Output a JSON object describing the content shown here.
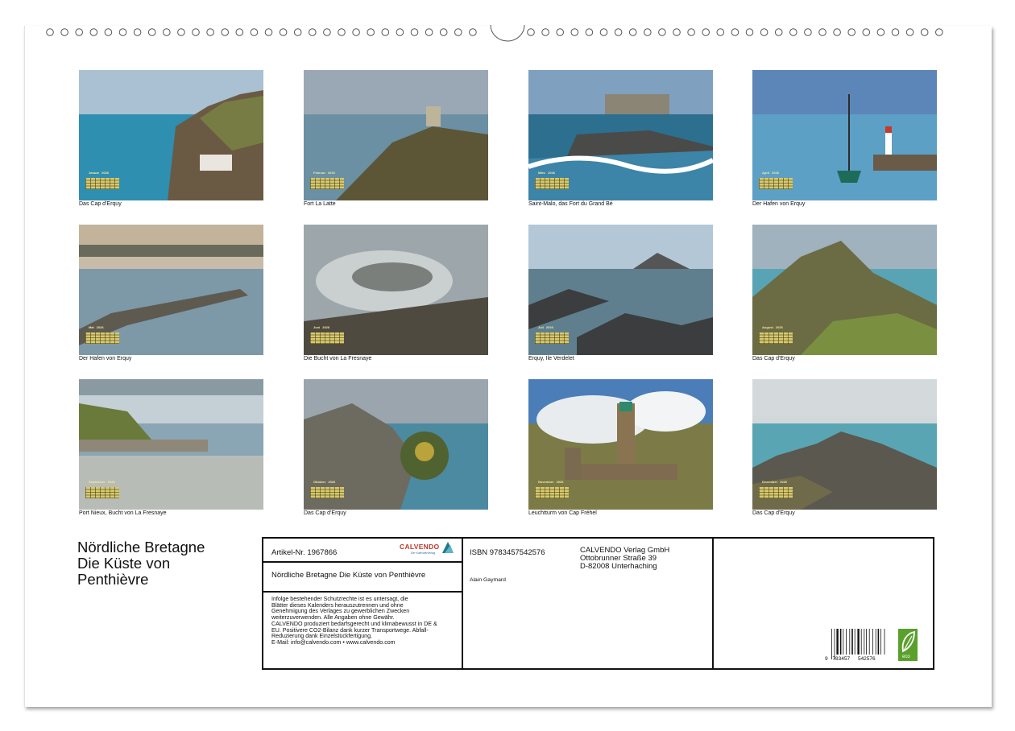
{
  "calendar": {
    "months": [
      {
        "month": "Januar",
        "year": "2026",
        "caption": "Das Cap d'Erquy"
      },
      {
        "month": "Februar",
        "year": "2026",
        "caption": "Fort La Latte"
      },
      {
        "month": "März",
        "year": "2026",
        "caption": "Saint-Malo, das Fort du Grand Bé"
      },
      {
        "month": "April",
        "year": "2026",
        "caption": "Der Hafen von Erquy"
      },
      {
        "month": "Mai",
        "year": "2026",
        "caption": "Der Hafen von Erquy"
      },
      {
        "month": "Juni",
        "year": "2026",
        "caption": "Die Bucht von La Fresnaye"
      },
      {
        "month": "Juli",
        "year": "2026",
        "caption": "Erquy, Ile Verdelet"
      },
      {
        "month": "August",
        "year": "2026",
        "caption": "Das Cap d'Erquy"
      },
      {
        "month": "September",
        "year": "2026",
        "caption": "Port Nieux, Bucht von La Fresnaye"
      },
      {
        "month": "Oktober",
        "year": "2026",
        "caption": "Das Cap d'Erquy"
      },
      {
        "month": "November",
        "year": "2026",
        "caption": "Leuchtturm von Cap Fréhel"
      },
      {
        "month": "Dezember",
        "year": "2026",
        "caption": "Das Cap d'Erquy"
      }
    ]
  },
  "title": {
    "line1": "Nördliche Bretagne",
    "line2": "Die Küste von",
    "line3": "Penthièvre"
  },
  "info": {
    "article": "Artikel-Nr. 1967866",
    "logo": "CALVENDO",
    "logo_sub": "Der Kalenderverlag",
    "box_title": "Nördliche Bretagne Die Küste von Penthièvre",
    "legal": [
      "Infolge bestehender Schutzrechte ist es untersagt, die",
      "Blätter dieses Kalenders herauszutrennen und ohne",
      "Genehmigung des Verlages zu gewerblichen Zwecken",
      "weiterzuverwenden. Alle Angaben ohne Gewähr.",
      "CALVENDO produziert bedarfsgerecht und klimabewusst in DE &",
      "EU. Positivere CO2-Bilanz dank kurzer Transportwege. Abfall-",
      "Reduzierung dank Einzelstückfertigung.",
      "E-Mail: info@calvendo.com • www.calvendo.com"
    ],
    "isbn": "ISBN 9783457542576",
    "author": "Alain Gaymard",
    "publisher": [
      "CALVENDO Verlag GmbH",
      "Ottobrunner Straße 39",
      "D-82008 Unterhaching"
    ],
    "barcode_digits": [
      "9",
      "783457",
      "542576"
    ],
    "eco_label": "eco"
  },
  "colors": {
    "sea": "#3f8fa8",
    "sky": "#c9d6de",
    "rock": "#6b5a43",
    "grass": "#6f8a3a",
    "calendar_grid": "#d8c874",
    "logo_red": "#c0392b",
    "eco_green": "#5aa02c"
  }
}
